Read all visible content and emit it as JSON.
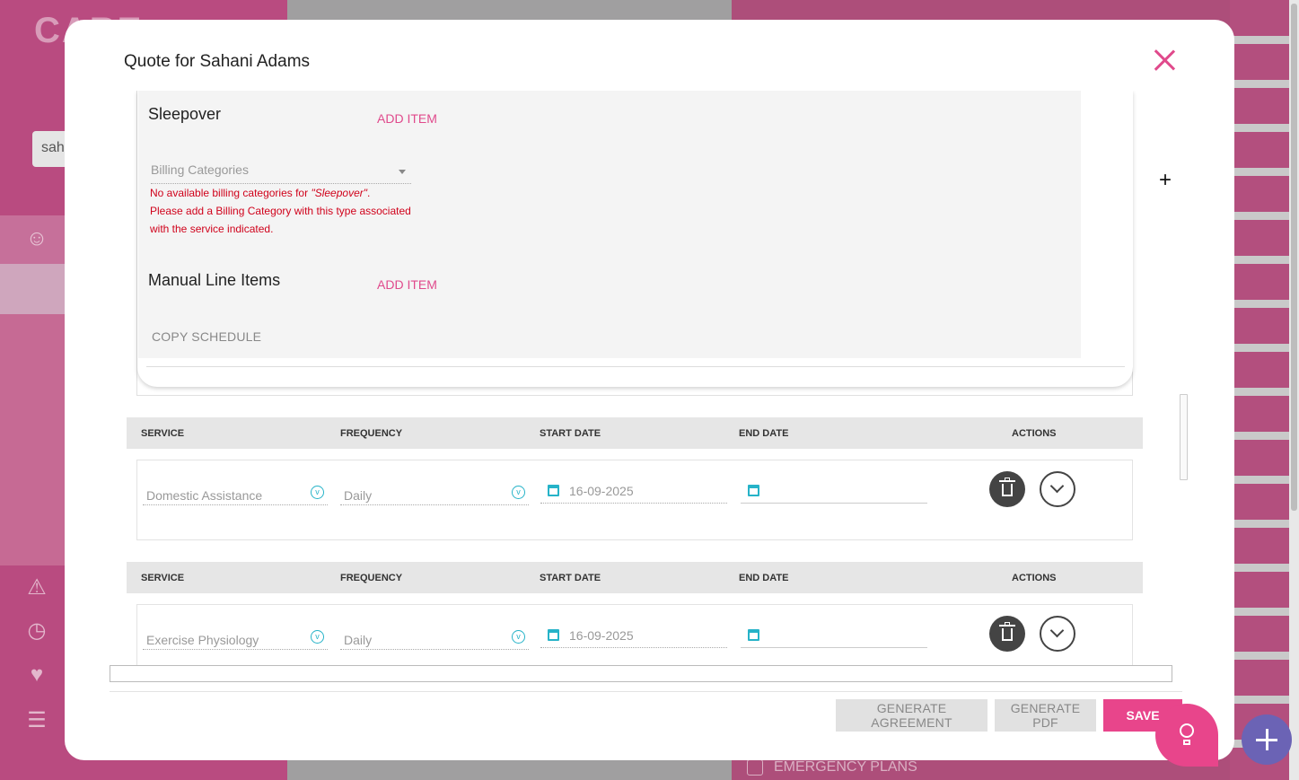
{
  "background": {
    "logo": "CARE",
    "search_value": "sah",
    "emergency_plans": "EMERGENCY PLANS"
  },
  "modal": {
    "title": "Quote for Sahani Adams",
    "sleepover": {
      "title": "Sleepover",
      "add_item": "ADD ITEM",
      "billing_placeholder": "Billing Categories",
      "error_line1_prefix": "No available billing categories for ",
      "error_line1_em": "\"Sleepover\"",
      "error_line1_suffix": ".",
      "error_line2": "Please add a Billing Category with this type associated with the service indicated."
    },
    "manual": {
      "title": "Manual Line Items",
      "add_item": "ADD ITEM"
    },
    "copy_schedule": "COPY SCHEDULE",
    "columns": {
      "service": "SERVICE",
      "frequency": "FREQUENCY",
      "start_date": "START DATE",
      "end_date": "END DATE",
      "actions": "ACTIONS"
    },
    "rows": [
      {
        "service": "Domestic Assistance",
        "frequency": "Daily",
        "start_date": "16-09-2025",
        "end_date": ""
      },
      {
        "service": "Exercise Physiology",
        "frequency": "Daily",
        "start_date": "16-09-2025",
        "end_date": ""
      }
    ],
    "footer": {
      "generate_agreement": "GENERATE AGREEMENT",
      "generate_pdf": "GENERATE PDF",
      "save": "SAVE"
    }
  },
  "colors": {
    "accent": "#e8458b",
    "error": "#d0021b",
    "icon_teal": "#26b3c8",
    "fab": "#6b63b5"
  },
  "icons": {
    "close": "close-icon",
    "add": "plus-icon",
    "calendar": "calendar-icon",
    "dropdown": "chevron-down-icon",
    "delete": "trash-icon",
    "expand": "chevron-down-icon",
    "help": "lightbulb-icon"
  }
}
